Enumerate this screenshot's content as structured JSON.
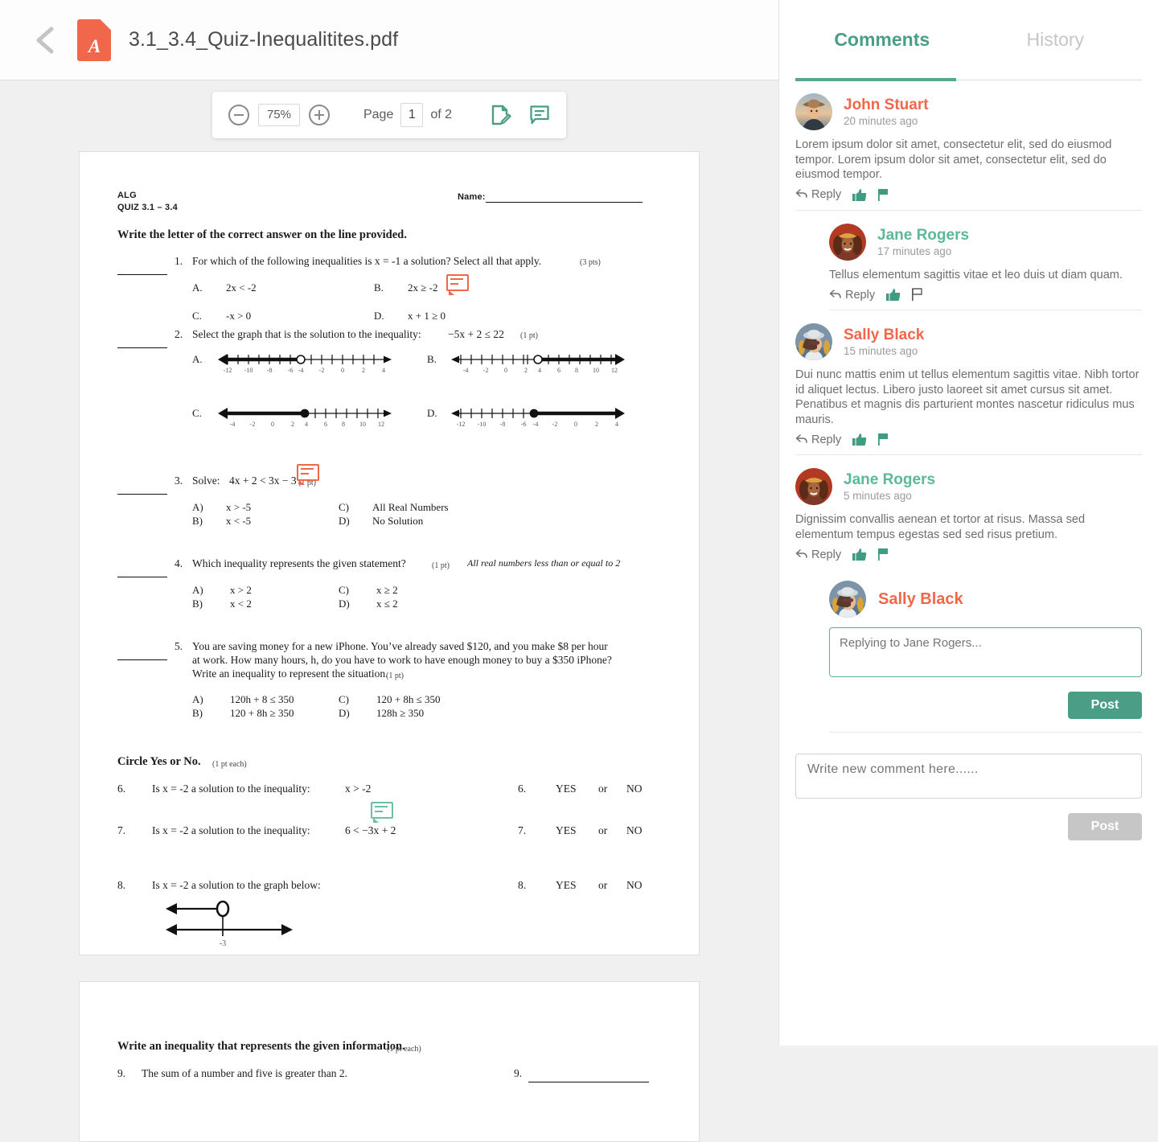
{
  "header": {
    "back_icon": "chevron-left-icon",
    "file_icon": "pdf-file-icon",
    "file_glyph": "A",
    "title": "3.1_3.4_Quiz-Inequalitites.pdf"
  },
  "toolbar": {
    "zoom_out_icon": "zoom-out-icon",
    "zoom_in_icon": "zoom-in-icon",
    "zoom_level": "75%",
    "page_label": "Page",
    "page_value": "1",
    "of_label": "of 2",
    "annotate_icon": "document-edit-icon",
    "comment_icon": "comment-icon"
  },
  "document": {
    "course": "ALG",
    "quiz": "QUIZ 3.1 – 3.4",
    "name_label": "Name:",
    "instruction_1": "Write the letter of the correct answer on the line provided.",
    "q1": {
      "num": "1.",
      "text": "For which of the following inequalities is x = -1 a solution?  Select all that apply.",
      "pts": "(3 pts)",
      "choices": [
        {
          "letter": "A.",
          "text": "2x < -2"
        },
        {
          "letter": "B.",
          "text": "2x ≥ -2"
        },
        {
          "letter": "C.",
          "text": "-x  > 0"
        },
        {
          "letter": "D.",
          "text": "x + 1 ≥ 0"
        }
      ]
    },
    "q2": {
      "num": "2.",
      "text": "Select the graph that is the solution to the inequality:",
      "expr": "−5x + 2 ≤ 22",
      "pts": "(1 pt)",
      "graphs": [
        {
          "letter": "A.",
          "ticks": [
            "-12",
            "-10",
            "-8",
            "-6",
            "-4",
            "-2",
            "0",
            "2",
            "4"
          ],
          "point": -4,
          "filled": false,
          "direction": "left"
        },
        {
          "letter": "B.",
          "ticks": [
            "-4",
            "-2",
            "0",
            "2",
            "4",
            "6",
            "8",
            "10",
            "12"
          ],
          "point": 4,
          "filled": false,
          "direction": "right"
        },
        {
          "letter": "C.",
          "ticks": [
            "-4",
            "-2",
            "0",
            "2",
            "4",
            "6",
            "8",
            "10",
            "12"
          ],
          "point": 4,
          "filled": true,
          "direction": "left"
        },
        {
          "letter": "D.",
          "ticks": [
            "-12",
            "-10",
            "-8",
            "-6",
            "-4",
            "-2",
            "0",
            "2",
            "4"
          ],
          "point": -4,
          "filled": true,
          "direction": "right"
        }
      ]
    },
    "q3": {
      "num": "3.",
      "text": "Solve:",
      "expr": "4x + 2 < 3x − 3",
      "pts": "(1 pt)",
      "choices": [
        {
          "letter": "A)",
          "text": "x > -5"
        },
        {
          "letter": "B)",
          "text": "x < -5"
        },
        {
          "letter": "C)",
          "text": "All Real Numbers"
        },
        {
          "letter": "D)",
          "text": "No Solution"
        }
      ]
    },
    "q4": {
      "num": "4.",
      "text": "Which inequality represents the given statement?",
      "pts": "(1 pt)",
      "statement": "All real numbers less than or equal to 2",
      "choices": [
        {
          "letter": "A)",
          "text": "x > 2"
        },
        {
          "letter": "B)",
          "text": "x < 2"
        },
        {
          "letter": "C)",
          "text": "x ≥ 2"
        },
        {
          "letter": "D)",
          "text": "x ≤ 2"
        }
      ]
    },
    "q5": {
      "num": "5.",
      "line1": "You are saving money for a new iPhone.  You’ve already saved $120, and you make $8 per hour",
      "line2": "at work.  How many hours, h, do you have to work to have enough money to buy a $350 iPhone?",
      "line3": "Write an inequality to represent the situation.",
      "pts": "(1 pt)",
      "choices": [
        {
          "letter": "A)",
          "text": "120h + 8 ≤ 350"
        },
        {
          "letter": "B)",
          "text": "120 + 8h ≥ 350"
        },
        {
          "letter": "C)",
          "text": "120 + 8h ≤ 350"
        },
        {
          "letter": "D)",
          "text": "128h ≥ 350"
        }
      ]
    },
    "instruction_2": "Circle Yes or No.",
    "instruction_2_pts": "(1 pt each)",
    "yes_no_rows": [
      {
        "num": "6.",
        "text": "Is x = -2 a solution to the inequality:",
        "expr": "x > -2",
        "rnum": "6.",
        "yes": "YES",
        "or": "or",
        "no": "NO"
      },
      {
        "num": "7.",
        "text": "Is x = -2 a solution to the inequality:",
        "expr": "6 < −3x + 2",
        "rnum": "7.",
        "yes": "YES",
        "or": "or",
        "no": "NO"
      },
      {
        "num": "8.",
        "text": "Is x = -2 a solution to the graph below:",
        "expr": "",
        "rnum": "8.",
        "yes": "YES",
        "or": "or",
        "no": "NO"
      }
    ],
    "q8_graph_label": "-3",
    "page2": {
      "instruction_3": "Write an inequality that represents the given information.",
      "instruction_3_pts": "(1 pt each)",
      "q9_num": "9.",
      "q9_text": "The sum of a number and five is greater than 2.",
      "q9_answer_num": "9."
    },
    "pins": [
      {
        "name": "comment-pin-q1b",
        "color": "#f1674b"
      },
      {
        "name": "comment-pin-q3",
        "color": "#f1674b"
      },
      {
        "name": "comment-pin-q7",
        "color": "#6bbfa8"
      }
    ]
  },
  "sidebar": {
    "tabs": [
      {
        "label": "Comments",
        "active": true
      },
      {
        "label": "History",
        "active": false
      }
    ],
    "reply_label": "Reply",
    "like_icon": "thumbs-up-icon",
    "flag_icon": "flag-icon",
    "reply_icon": "reply-arrow-icon",
    "comments": [
      {
        "name": "John Stuart",
        "name_color": "#f1674b",
        "time": "20 minutes ago",
        "body": "Lorem ipsum dolor sit amet, consectetur elit, sed do eiusmod tempor. Lorem ipsum dolor sit amet, consectetur elit, sed do eiusmod tempor.",
        "nested": false
      },
      {
        "name": "Jane Rogers",
        "name_color": "#5cb79b",
        "time": "17 minutes ago",
        "body": "Tellus elementum sagittis vitae et leo duis ut diam quam.",
        "nested": true
      },
      {
        "name": "Sally Black",
        "name_color": "#f1674b",
        "time": "15 minutes ago",
        "body": "Dui nunc mattis enim ut tellus elementum sagittis vitae. Nibh tortor id aliquet lectus. Libero justo laoreet sit amet cursus sit amet. Penatibus et magnis dis parturient montes nascetur ridiculus mus mauris.",
        "nested": false
      },
      {
        "name": "Jane Rogers",
        "name_color": "#5cb79b",
        "time": "5 minutes ago",
        "body": "Dignissim convallis aenean et tortor at risus. Massa sed elementum tempus egestas sed sed risus pretium.",
        "nested": false
      }
    ],
    "reply_box": {
      "author": "Sally Black",
      "author_color": "#f1674b",
      "placeholder": "Replying to Jane Rogers...",
      "value": "",
      "post_label": "Post"
    },
    "new_comment": {
      "placeholder": "Write new comment here......",
      "value": "",
      "post_label": "Post"
    }
  },
  "colors": {
    "accent_green": "#4a9e85",
    "accent_orange": "#f1674b",
    "muted": "#9b9b9b"
  }
}
